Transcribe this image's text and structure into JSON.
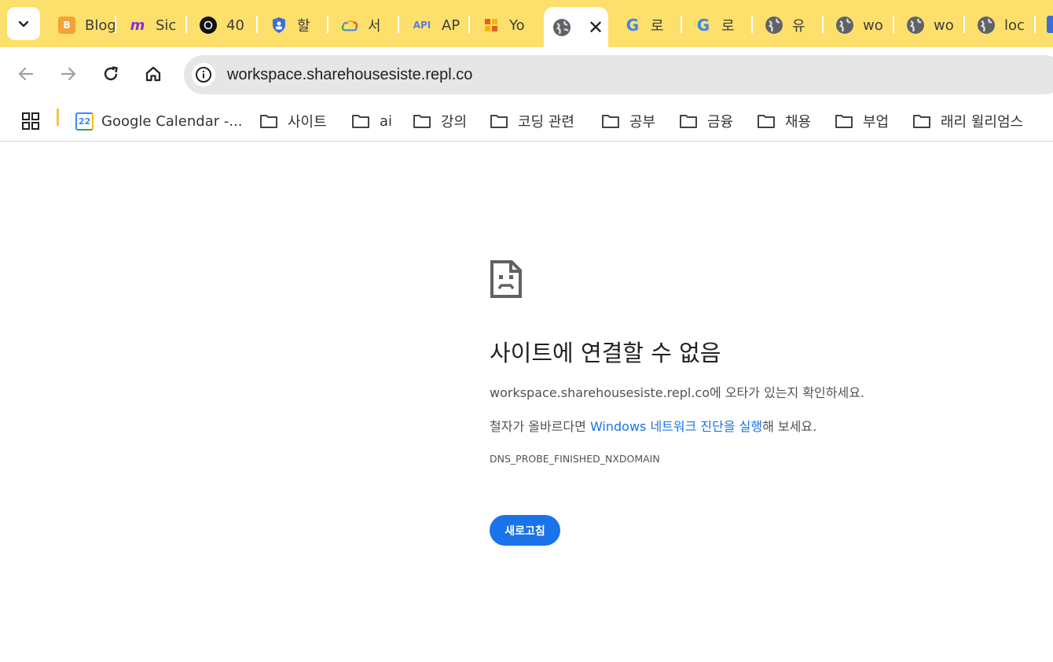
{
  "tabs": [
    {
      "title": "Blog",
      "icon": "blogger-icon",
      "color": "#f4a23a"
    },
    {
      "title": "Sic",
      "icon": "make-icon",
      "color": "#8a2be2"
    },
    {
      "title": "40",
      "icon": "openai-icon",
      "color": "#111111"
    },
    {
      "title": "할",
      "icon": "shield-icon",
      "color": "#3b6fd8"
    },
    {
      "title": "서",
      "icon": "google-cloud-icon",
      "color": "#4285f4"
    },
    {
      "title": "AP",
      "icon": "api-icon",
      "color": "#5b7be0"
    },
    {
      "title": "Yo",
      "icon": "app-icon",
      "color": "#e85c2c"
    },
    {
      "title": "",
      "icon": "globe-icon",
      "color": "#5f6368",
      "active": true
    },
    {
      "title": "로",
      "icon": "google-icon",
      "color": "#4285f4"
    },
    {
      "title": "로",
      "icon": "google-icon",
      "color": "#4285f4"
    },
    {
      "title": "유",
      "icon": "globe-icon",
      "color": "#5f6368"
    },
    {
      "title": "wo",
      "icon": "globe-icon",
      "color": "#5f6368"
    },
    {
      "title": "wo",
      "icon": "globe-icon",
      "color": "#5f6368"
    },
    {
      "title": "loc",
      "icon": "globe-icon",
      "color": "#5f6368"
    }
  ],
  "omnibox": {
    "url": "workspace.sharehousesiste.repl.co"
  },
  "bookmarks": {
    "calendar": "Google Calendar -...",
    "calendar_day": "22",
    "folders": [
      "사이트",
      "ai",
      "강의",
      "코딩 관련",
      "공부",
      "금융",
      "채용",
      "부업",
      "래리 윌리엄스"
    ]
  },
  "error": {
    "title": "사이트에 연결할 수 없음",
    "message_host": "workspace.sharehousesiste.repl.co",
    "message_rest": "에 오타가 있는지 확인하세요.",
    "suggest_prefix": "철자가 올바르다면 ",
    "suggest_link": "Windows 네트워크 진단을 실행",
    "suggest_suffix": "해 보세요.",
    "code": "DNS_PROBE_FINISHED_NXDOMAIN",
    "reload_label": "새로고침"
  },
  "colors": {
    "tabstrip": "#fde06b",
    "accent": "#1a73e8"
  }
}
